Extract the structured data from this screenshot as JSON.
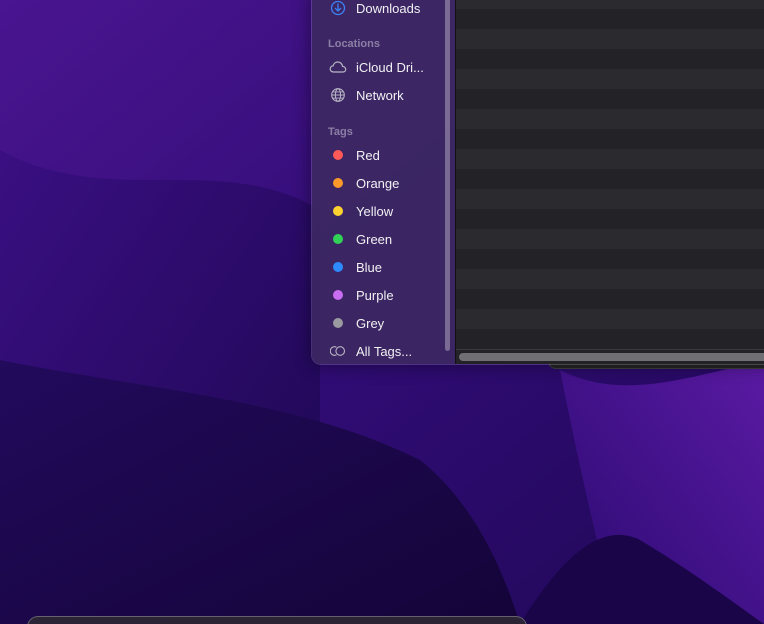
{
  "sidebar": {
    "favorites": [
      {
        "label": "Downloads",
        "icon": "download-icon",
        "color": "#3b82f6"
      }
    ],
    "locations": {
      "title": "Locations",
      "items": [
        {
          "label": "iCloud Dri...",
          "icon": "cloud-icon"
        },
        {
          "label": "Network",
          "icon": "globe-icon"
        }
      ]
    },
    "tags": {
      "title": "Tags",
      "items": [
        {
          "label": "Red",
          "color": "#ff5a58"
        },
        {
          "label": "Orange",
          "color": "#fb9a2b"
        },
        {
          "label": "Yellow",
          "color": "#fdd12f"
        },
        {
          "label": "Green",
          "color": "#31d158"
        },
        {
          "label": "Blue",
          "color": "#2e8bff"
        },
        {
          "label": "Purple",
          "color": "#c86df2"
        },
        {
          "label": "Grey",
          "color": "#9a9aa0"
        }
      ],
      "all_tags_label": "All Tags...",
      "all_tags_icon": "all-tags-icon"
    }
  },
  "colors": {
    "accent": "#3b82f6",
    "wallpaper_base": "#2a0a66",
    "content_row_odd": "#2b2a2e",
    "content_row_even": "#232226"
  }
}
